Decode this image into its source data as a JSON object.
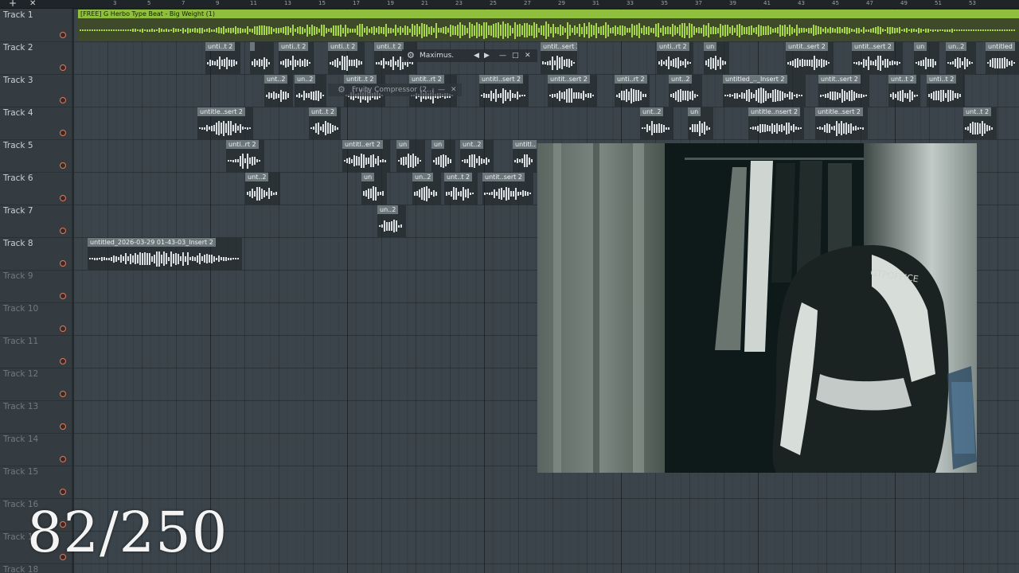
{
  "toolbar": {
    "plus_icon": "+",
    "close_icon": "✕"
  },
  "ruler": {
    "bars": [
      "3",
      "5",
      "7",
      "9",
      "11",
      "13",
      "15",
      "17",
      "19",
      "21",
      "23",
      "25",
      "27",
      "29",
      "31",
      "33",
      "35",
      "37",
      "39",
      "41",
      "43",
      "45",
      "47",
      "49",
      "51",
      "53"
    ]
  },
  "tracks": [
    {
      "label": "Track 1"
    },
    {
      "label": "Track 2"
    },
    {
      "label": "Track 3"
    },
    {
      "label": "Track 4"
    },
    {
      "label": "Track 5"
    },
    {
      "label": "Track 6"
    },
    {
      "label": "Track 7"
    },
    {
      "label": "Track 8"
    },
    {
      "label": "Track 9"
    },
    {
      "label": "Track 10"
    },
    {
      "label": "Track 11"
    },
    {
      "label": "Track 12"
    },
    {
      "label": "Track 13"
    },
    {
      "label": "Track 14"
    },
    {
      "label": "Track 15"
    },
    {
      "label": "Track 16"
    },
    {
      "label": "Track 17"
    },
    {
      "label": "Track 18"
    }
  ],
  "main_clip": {
    "title": "[FREE] G Herbo Type Beat - Big Weight (1)"
  },
  "clips": {
    "t2": [
      "unti..t 2",
      "",
      "unti..t 2",
      "unti..t 2",
      "unti..t 2",
      "untit..sert 2",
      "unti..rt 2",
      "un",
      "untit..sert 2",
      "untit..sert 2",
      "un",
      "un..2",
      "untitled"
    ],
    "t3": [
      "unt..2",
      "un..2",
      "untit..t 2",
      "untit..rt 2",
      "untitl..sert 2",
      "untit..sert 2",
      "unti..rt 2",
      "unt..2",
      "untitled_.._Insert 2",
      "untit..sert 2",
      "unt..t 2",
      "unti..t 2"
    ],
    "t4": [
      "untitle..sert 2",
      "unt..t 2",
      "unt..2",
      "un",
      "untitle..nsert 2",
      "untitle..sert 2",
      "unt..t 2"
    ],
    "t5": [
      "unti..rt 2",
      "untitl..ert 2",
      "un",
      "un",
      "unt..2",
      "untitl..."
    ],
    "t6": [
      "unt..2",
      "un",
      "un..2",
      "unt..t 2",
      "untit..sert 2"
    ],
    "t7": [
      "un..2"
    ],
    "t8": [
      "untitled_2026-03-29 01-43-03_Insert 2"
    ]
  },
  "windows": {
    "maximus": {
      "title": "Maximus."
    },
    "compressor": {
      "title": "Fruity Compressor (2..."
    }
  },
  "webcam": {
    "chair_brand": "GTPOFFICE"
  },
  "counter": {
    "text": "82/250"
  }
}
